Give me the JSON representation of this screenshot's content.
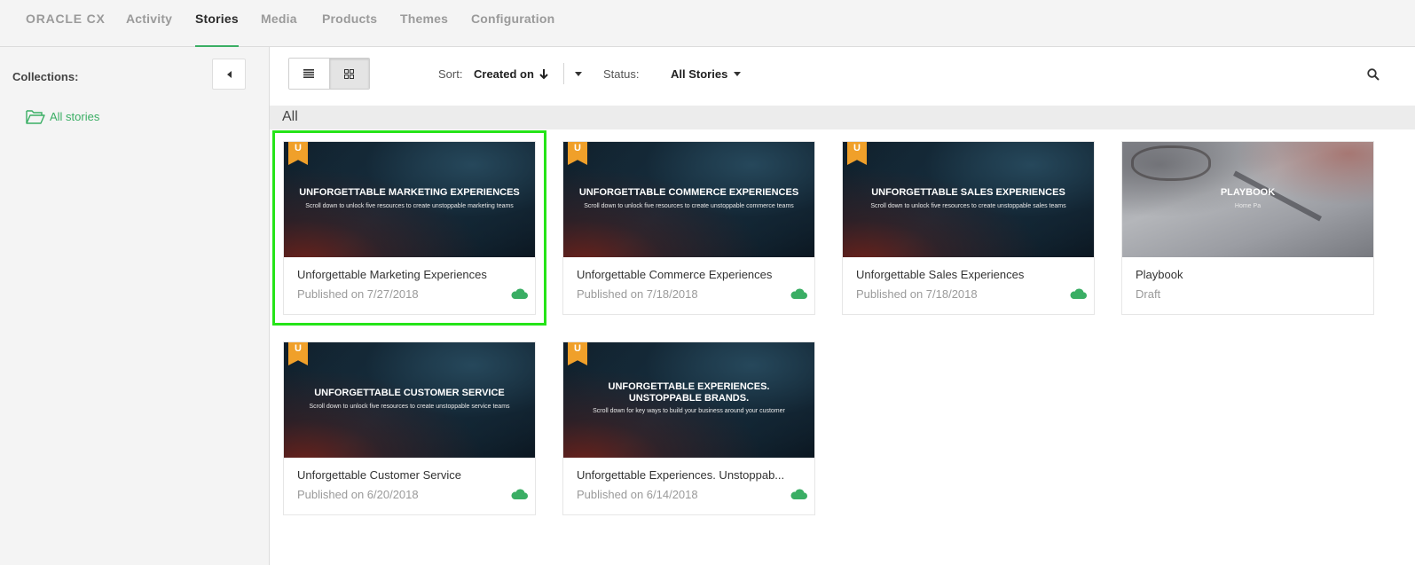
{
  "nav": {
    "brand": "ORACLE CX",
    "items": [
      "Activity",
      "Stories",
      "Media",
      "Products",
      "Themes",
      "Configuration"
    ],
    "active": "Stories"
  },
  "sidebar": {
    "collections_label": "Collections:",
    "all_stories": "All stories"
  },
  "toolbar": {
    "sort_label": "Sort:",
    "sort_value": "Created on",
    "status_label": "Status:",
    "status_value": "All Stories"
  },
  "section": {
    "title": "All"
  },
  "stories": [
    {
      "badge": "U",
      "thumb_title": "UNFORGETTABLE MARKETING EXPERIENCES",
      "thumb_sub": "Scroll down to unlock five resources to create unstoppable marketing teams",
      "title": "Unforgettable Marketing Experiences",
      "status": "Published on 7/27/2018",
      "selected": true
    },
    {
      "badge": "U",
      "thumb_title": "UNFORGETTABLE COMMERCE EXPERIENCES",
      "thumb_sub": "Scroll down to unlock five resources to create unstoppable commerce teams",
      "title": "Unforgettable Commerce Experiences",
      "status": "Published on 7/18/2018",
      "selected": false
    },
    {
      "badge": "U",
      "thumb_title": "UNFORGETTABLE SALES EXPERIENCES",
      "thumb_sub": "Scroll down to unlock five resources to create unstoppable sales teams",
      "title": "Unforgettable Sales Experiences",
      "status": "Published on 7/18/2018",
      "selected": false
    },
    {
      "badge": "",
      "thumb_title": "PLAYBOOK",
      "thumb_sub": "Home Pa",
      "title": "Playbook",
      "status": "Draft",
      "selected": false
    },
    {
      "badge": "U",
      "thumb_title": "UNFORGETTABLE CUSTOMER SERVICE",
      "thumb_sub": "Scroll down to unlock five resources to create unstoppable service teams",
      "title": "Unforgettable Customer Service",
      "status": "Published on 6/20/2018",
      "selected": false
    },
    {
      "badge": "U",
      "thumb_title": "UNFORGETTABLE EXPERIENCES. UNSTOPPABLE BRANDS.",
      "thumb_sub": "Scroll down for key ways to build your business around your customer",
      "title": "Unforgettable Experiences. Unstoppab...",
      "status": "Published on 6/14/2018",
      "selected": false
    }
  ],
  "colors": {
    "accent": "#3aae64",
    "ribbon": "#f0a02a",
    "selection": "#25e418"
  }
}
